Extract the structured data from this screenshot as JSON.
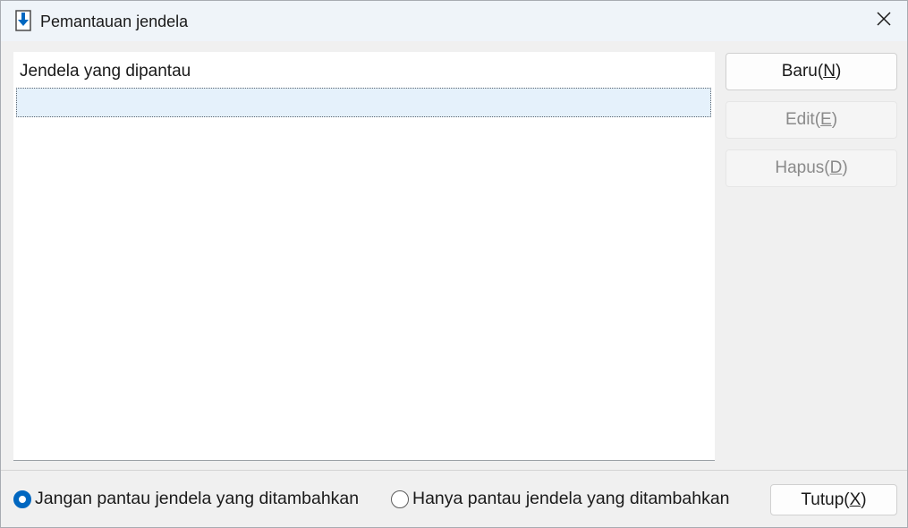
{
  "window": {
    "title": "Pemantauan jendela",
    "app_icon": "download-arrow-icon",
    "close_icon": "close-icon"
  },
  "list": {
    "header": "Jendela yang dipantau",
    "rows": [
      ""
    ]
  },
  "buttons": {
    "new": {
      "label": "Baru(",
      "mnemonic": "N",
      "suffix": ")",
      "enabled": true
    },
    "edit": {
      "label": "Edit(",
      "mnemonic": "E",
      "suffix": ")",
      "enabled": false
    },
    "delete": {
      "label": "Hapus(",
      "mnemonic": "D",
      "suffix": ")",
      "enabled": false
    },
    "close": {
      "label": "Tutup(",
      "mnemonic": "X",
      "suffix": ")",
      "enabled": true
    }
  },
  "options": {
    "exclude_added": {
      "label": "Jangan pantau jendela yang ditambahkan",
      "selected": true
    },
    "only_added": {
      "label": "Hanya pantau jendela yang ditambahkan",
      "selected": false
    }
  },
  "colors": {
    "accent": "#0067c0",
    "selection": "#e5f1fb",
    "titlebar": "#eff4f9",
    "window_bg": "#f0f0f0"
  }
}
